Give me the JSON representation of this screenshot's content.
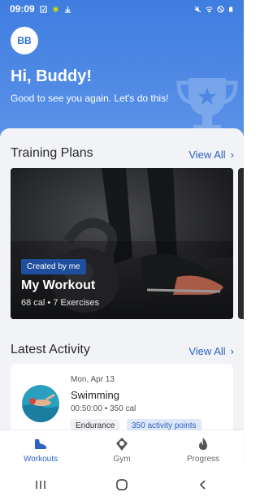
{
  "status_bar": {
    "time": "09:09",
    "icons_left": [
      "sim-icon",
      "android-icon",
      "download-icon"
    ],
    "icons_right": [
      "mute-icon",
      "wifi-icon",
      "dnd-icon",
      "battery-icon"
    ]
  },
  "header": {
    "avatar_initials": "BB",
    "greeting": "Hi, Buddy!",
    "subtitle": "Good to see you again. Let's do this!"
  },
  "training_plans": {
    "title": "Training Plans",
    "view_all": "View All",
    "cards": [
      {
        "tag": "Created by me",
        "title": "My Workout",
        "meta": "68 cal • 7 Exercises"
      }
    ]
  },
  "latest_activity": {
    "title": "Latest Activity",
    "view_all": "View All",
    "items": [
      {
        "date": "Mon, Apr 13",
        "title": "Swimming",
        "meta": "00:50:00 • 350 cal",
        "badges": [
          "Endurance",
          "350 activity points"
        ]
      }
    ]
  },
  "bottom_nav": {
    "items": [
      {
        "label": "Workouts",
        "icon": "shoe-icon",
        "active": true
      },
      {
        "label": "Gym",
        "icon": "location-pin-icon",
        "active": false
      },
      {
        "label": "Progress",
        "icon": "flame-icon",
        "active": false
      }
    ]
  },
  "colors": {
    "header_blue": "#3f7de0",
    "accent": "#2c62c4",
    "sheet_bg": "#f2f3f6"
  }
}
